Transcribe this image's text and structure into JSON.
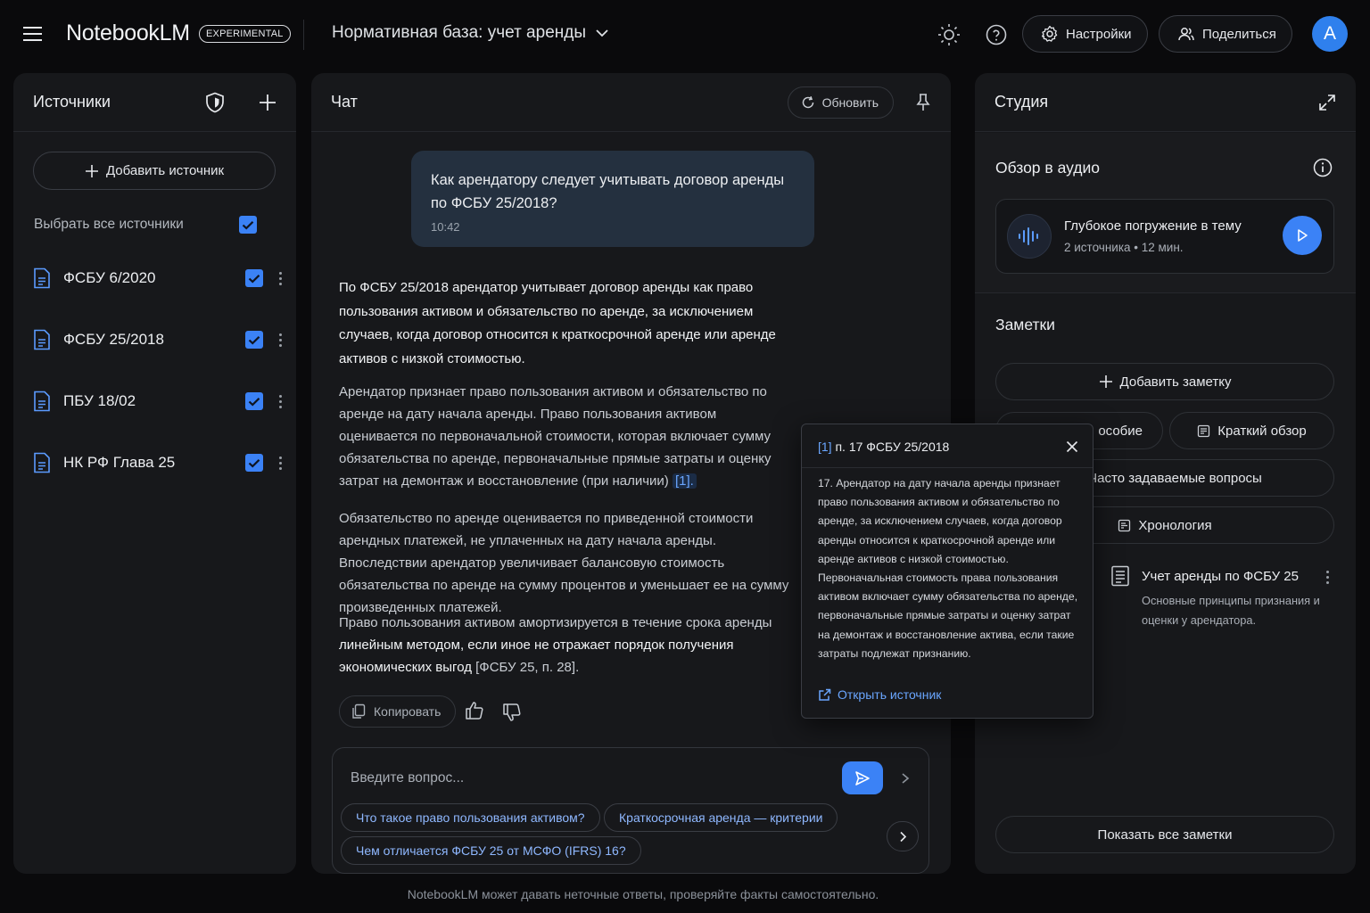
{
  "header": {
    "brand": "NotebookLM",
    "badge": "EXPERIMENTAL",
    "notebook_title": "Нормативная база: учет аренды",
    "settings_label": "Настройки",
    "share_label": "Поделиться",
    "avatar_letter": "A"
  },
  "sources": {
    "title": "Источники",
    "add_label": "Добавить источник",
    "select_all_label": "Выбрать все источники",
    "items": [
      {
        "label": "ФСБУ 6/2020",
        "checked": true
      },
      {
        "label": "ФСБУ 25/2018",
        "checked": true
      },
      {
        "label": "ПБУ 18/02",
        "checked": true
      },
      {
        "label": "НК РФ Глава 25",
        "checked": true
      }
    ]
  },
  "chat": {
    "title": "Чат",
    "refresh_label": "Обновить",
    "user_message": "Как арендатору следует учитывать договор аренды по ФСБУ 25/2018?",
    "user_time": "10:42",
    "answer": {
      "p1": "По ФСБУ 25/2018 арендатор учитывает договор аренды как право пользования активом и обязательство по аренде, за исключением случаев, когда договор относится к краткосрочной аренде или аренде активов с низкой стоимостью.",
      "p2": "Арендатор признает право пользования активом и обязательство по аренде на дату начала аренды. Право пользования активом оценивается по первоначальной стоимости, которая включает сумму обязательства по аренде, первоначальные прямые затраты и оценку затрат на демонтаж и восстановление (при наличии)",
      "p2_cite": "[1].",
      "p3": "Обязательство по аренде оценивается по приведенной стоимости арендных платежей, не уплаченных на дату начала аренды. Впоследствии арендатор увеличивает балансовую стоимость обязательства по аренде на сумму процентов и уменьшает ее на сумму произведенных платежей.",
      "p4_a": "Право пользования активом амортизируется в течение срока аренды",
      "p4_b": "линейным методом, если иное не отражает порядок получения экономических выгод",
      "p4_c": "[ФСБУ 25, п. 28]."
    },
    "copy_label": "Копировать",
    "input_placeholder": "Введите вопрос...",
    "suggestions": [
      "Что такое право пользования активом?",
      "Краткосрочная аренда — критерии",
      "Чем отличается ФСБУ 25 от МСФО (IFRS) 16?"
    ]
  },
  "citation_popup": {
    "ref": "[1]",
    "title": "п. 17 ФСБУ 25/2018",
    "body": "17. Арендатор на дату начала аренды признает право пользования активом и обязательство по аренде, за исключением случаев, когда договор аренды относится к краткосрочной аренде или аренде активов с низкой стоимостью. Первоначальная стоимость права пользования активом включает сумму обязательства по аренде, первоначальные прямые затраты и оценку затрат на демонтаж и восстановление актива, если такие затраты подлежат признанию.",
    "open_label": "Открыть источник"
  },
  "studio": {
    "title": "Студия",
    "audio_title": "Обзор в аудио",
    "audio_card_title": "Глубокое погружение в тему",
    "audio_card_meta": "2 источника • 12 мин.",
    "notes_title": "Заметки",
    "add_note_label": "Добавить заметку",
    "study_guide_partial": "особие",
    "brief_label": "Краткий обзор",
    "faq_label": "Часто задаваемые вопросы",
    "timeline_label": "Хронология",
    "note_title": "Учет аренды по ФСБУ 25",
    "note_desc": "Основные принципы признания и оценки у арендатора.",
    "show_all_label": "Показать все заметки"
  },
  "footer": {
    "disclaimer": "NotebookLM может давать неточные ответы, проверяйте факты самостоятельно."
  },
  "colors": {
    "accent": "#3b82f6",
    "panel": "#17181b",
    "background": "#0a0a0c",
    "link": "#6aa6ff"
  }
}
